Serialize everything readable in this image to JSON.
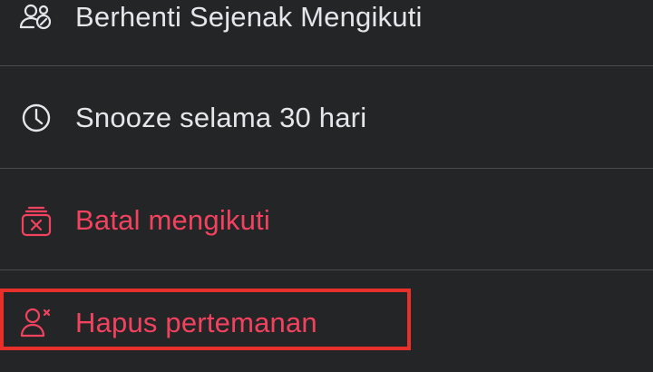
{
  "colors": {
    "background": "#242526",
    "text_default": "#e4e6eb",
    "text_danger": "#f3425f",
    "divider": "#4a4b4c",
    "highlight_border": "#e8302a"
  },
  "menu": {
    "items": [
      {
        "label": "Berhenti Sejenak Mengikuti",
        "icon": "pause-follow-people-icon",
        "tone": "default"
      },
      {
        "label": "Snooze selama 30 hari",
        "icon": "clock-icon",
        "tone": "default"
      },
      {
        "label": "Batal mengikuti",
        "icon": "unfollow-box-x-icon",
        "tone": "danger"
      },
      {
        "label": "Hapus pertemanan",
        "icon": "remove-friend-icon",
        "tone": "danger",
        "highlighted": true
      }
    ]
  }
}
